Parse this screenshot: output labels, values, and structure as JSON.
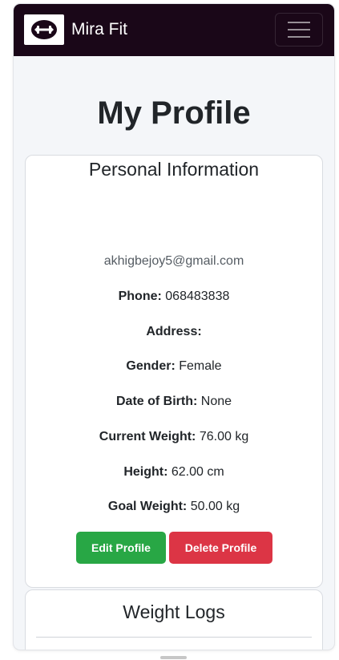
{
  "navbar": {
    "brand_name": "Mira Fit",
    "logo_icon": "dumbbell-icon",
    "menu_icon": "hamburger-icon",
    "background_color": "#1a0718"
  },
  "page": {
    "title": "My Profile"
  },
  "profile": {
    "section_title": "Personal Information",
    "email": "akhigbejoy5@gmail.com",
    "phone_label": "Phone:",
    "phone_value": "068483838",
    "address_label": "Address:",
    "address_value": "",
    "gender_label": "Gender:",
    "gender_value": "Female",
    "dob_label": "Date of Birth:",
    "dob_value": "None",
    "current_weight_label": "Current Weight:",
    "current_weight_value": "76.00 kg",
    "height_label": "Height:",
    "height_value": "62.00 cm",
    "goal_weight_label": "Goal Weight:",
    "goal_weight_value": "50.00 kg",
    "edit_button_label": "Edit Profile",
    "delete_button_label": "Delete Profile",
    "edit_button_color": "#28a745",
    "delete_button_color": "#dc3545"
  },
  "weight_logs": {
    "section_title": "Weight Logs"
  }
}
